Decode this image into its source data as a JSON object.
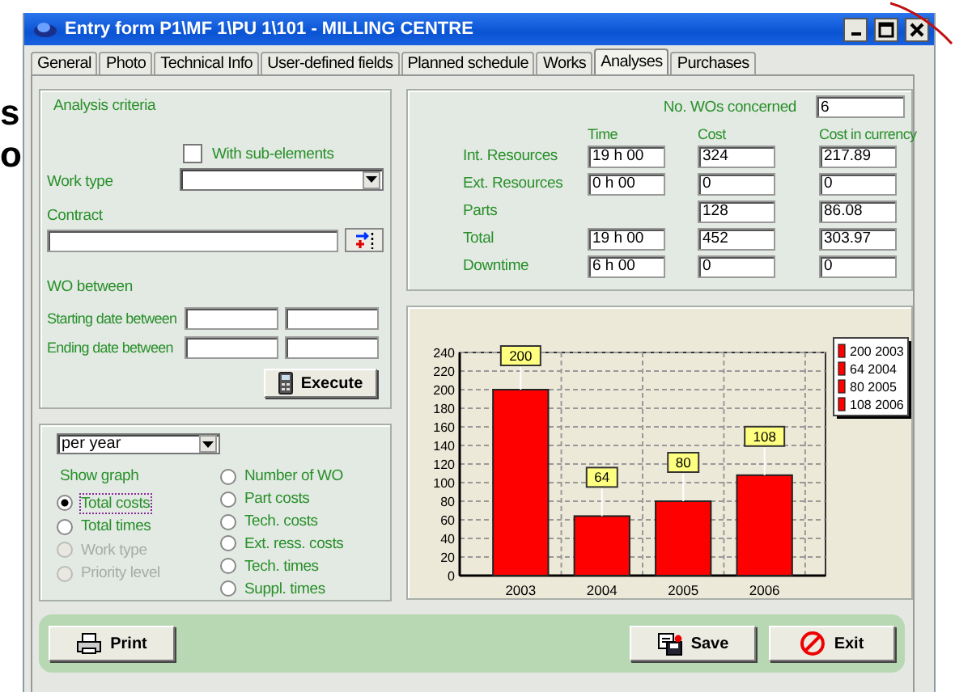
{
  "background_text": [
    "s",
    "o"
  ],
  "window": {
    "title": "Entry form P1\\MF 1\\PU 1\\101 - MILLING CENTRE"
  },
  "tabs": [
    {
      "label": "General",
      "selected": false
    },
    {
      "label": "Photo",
      "selected": false
    },
    {
      "label": "Technical Info",
      "selected": false
    },
    {
      "label": "User-defined fields",
      "selected": false
    },
    {
      "label": "Planned schedule",
      "selected": false
    },
    {
      "label": "Works",
      "selected": false
    },
    {
      "label": "Analyses",
      "selected": true
    },
    {
      "label": "Purchases",
      "selected": false
    }
  ],
  "criteria": {
    "title": "Analysis criteria",
    "with_sub_elements": {
      "label": "With sub-elements",
      "checked": false
    },
    "work_type_label": "Work type",
    "contract_label": "Contract",
    "wo_between": "WO between",
    "starting_label": "Starting date between",
    "ending_label": "Ending date between",
    "execute": "Execute"
  },
  "graph_options": {
    "period": "per year",
    "show_graph": "Show graph",
    "left": [
      {
        "label": "Total costs",
        "selected": true,
        "disabled": false
      },
      {
        "label": "Total times",
        "selected": false,
        "disabled": false
      },
      {
        "label": "Work type",
        "selected": false,
        "disabled": true
      },
      {
        "label": "Priority level",
        "selected": false,
        "disabled": true
      }
    ],
    "right": [
      {
        "label": "Number of WO",
        "selected": false,
        "disabled": false
      },
      {
        "label": "Part costs",
        "selected": false,
        "disabled": false
      },
      {
        "label": "Tech. costs",
        "selected": false,
        "disabled": false
      },
      {
        "label": "Ext. ress. costs",
        "selected": false,
        "disabled": false
      },
      {
        "label": "Tech. times",
        "selected": false,
        "disabled": false
      },
      {
        "label": "Suppl. times",
        "selected": false,
        "disabled": false
      }
    ]
  },
  "summary": {
    "wos_label": "No. WOs concerned",
    "wos_value": "6",
    "columns": [
      "Time",
      "Cost",
      "Cost in currency"
    ],
    "rows": [
      {
        "label": "Int. Resources",
        "time": "19 h 00",
        "cost": "324",
        "currency": "217.89"
      },
      {
        "label": "Ext. Resources",
        "time": "0 h 00",
        "cost": "0",
        "currency": "0"
      },
      {
        "label": "Parts",
        "cost": "128",
        "currency": "86.08"
      },
      {
        "label": "Total",
        "time": "19 h 00",
        "cost": "452",
        "currency": "303.97"
      },
      {
        "label": "Downtime",
        "time": "6 h 00",
        "cost": "0",
        "currency": "0"
      }
    ]
  },
  "chart": {
    "chart_data": {
      "type": "bar",
      "categories": [
        "2003",
        "2004",
        "2005",
        "2006"
      ],
      "series": [
        {
          "color": "#ff0000",
          "values": [
            200,
            64,
            80,
            108
          ]
        }
      ],
      "grid": true,
      "ylim": [
        0,
        240
      ],
      "yticks": [
        0,
        20,
        40,
        60,
        80,
        100,
        120,
        140,
        160,
        180,
        200,
        220,
        240
      ],
      "data_labels": true
    },
    "legend": [
      "200 2003",
      "64 2004",
      "80 2005",
      "108 2006"
    ]
  },
  "buttons": {
    "print": "Print",
    "save": "Save",
    "exit": "Exit"
  }
}
